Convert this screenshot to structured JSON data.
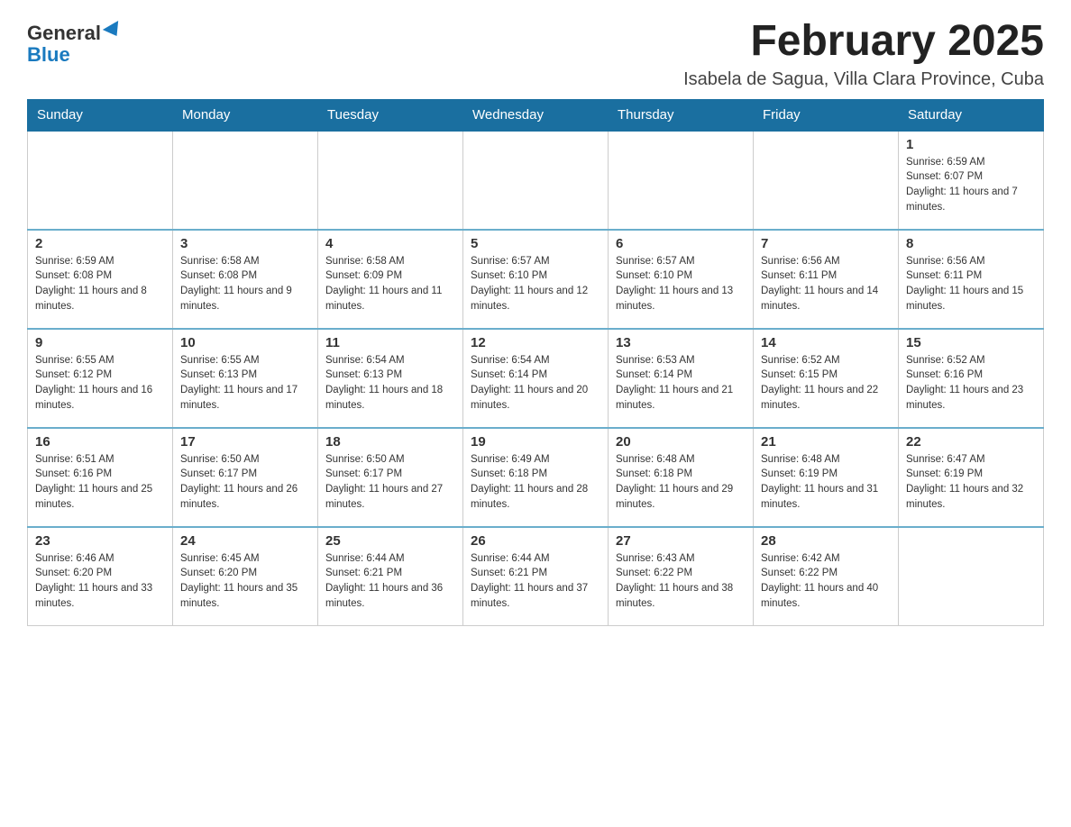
{
  "header": {
    "logo_line1": "General",
    "logo_line2": "Blue",
    "month_title": "February 2025",
    "subtitle": "Isabela de Sagua, Villa Clara Province, Cuba"
  },
  "days_of_week": [
    "Sunday",
    "Monday",
    "Tuesday",
    "Wednesday",
    "Thursday",
    "Friday",
    "Saturday"
  ],
  "weeks": [
    [
      {
        "day": "",
        "info": ""
      },
      {
        "day": "",
        "info": ""
      },
      {
        "day": "",
        "info": ""
      },
      {
        "day": "",
        "info": ""
      },
      {
        "day": "",
        "info": ""
      },
      {
        "day": "",
        "info": ""
      },
      {
        "day": "1",
        "info": "Sunrise: 6:59 AM\nSunset: 6:07 PM\nDaylight: 11 hours and 7 minutes."
      }
    ],
    [
      {
        "day": "2",
        "info": "Sunrise: 6:59 AM\nSunset: 6:08 PM\nDaylight: 11 hours and 8 minutes."
      },
      {
        "day": "3",
        "info": "Sunrise: 6:58 AM\nSunset: 6:08 PM\nDaylight: 11 hours and 9 minutes."
      },
      {
        "day": "4",
        "info": "Sunrise: 6:58 AM\nSunset: 6:09 PM\nDaylight: 11 hours and 11 minutes."
      },
      {
        "day": "5",
        "info": "Sunrise: 6:57 AM\nSunset: 6:10 PM\nDaylight: 11 hours and 12 minutes."
      },
      {
        "day": "6",
        "info": "Sunrise: 6:57 AM\nSunset: 6:10 PM\nDaylight: 11 hours and 13 minutes."
      },
      {
        "day": "7",
        "info": "Sunrise: 6:56 AM\nSunset: 6:11 PM\nDaylight: 11 hours and 14 minutes."
      },
      {
        "day": "8",
        "info": "Sunrise: 6:56 AM\nSunset: 6:11 PM\nDaylight: 11 hours and 15 minutes."
      }
    ],
    [
      {
        "day": "9",
        "info": "Sunrise: 6:55 AM\nSunset: 6:12 PM\nDaylight: 11 hours and 16 minutes."
      },
      {
        "day": "10",
        "info": "Sunrise: 6:55 AM\nSunset: 6:13 PM\nDaylight: 11 hours and 17 minutes."
      },
      {
        "day": "11",
        "info": "Sunrise: 6:54 AM\nSunset: 6:13 PM\nDaylight: 11 hours and 18 minutes."
      },
      {
        "day": "12",
        "info": "Sunrise: 6:54 AM\nSunset: 6:14 PM\nDaylight: 11 hours and 20 minutes."
      },
      {
        "day": "13",
        "info": "Sunrise: 6:53 AM\nSunset: 6:14 PM\nDaylight: 11 hours and 21 minutes."
      },
      {
        "day": "14",
        "info": "Sunrise: 6:52 AM\nSunset: 6:15 PM\nDaylight: 11 hours and 22 minutes."
      },
      {
        "day": "15",
        "info": "Sunrise: 6:52 AM\nSunset: 6:16 PM\nDaylight: 11 hours and 23 minutes."
      }
    ],
    [
      {
        "day": "16",
        "info": "Sunrise: 6:51 AM\nSunset: 6:16 PM\nDaylight: 11 hours and 25 minutes."
      },
      {
        "day": "17",
        "info": "Sunrise: 6:50 AM\nSunset: 6:17 PM\nDaylight: 11 hours and 26 minutes."
      },
      {
        "day": "18",
        "info": "Sunrise: 6:50 AM\nSunset: 6:17 PM\nDaylight: 11 hours and 27 minutes."
      },
      {
        "day": "19",
        "info": "Sunrise: 6:49 AM\nSunset: 6:18 PM\nDaylight: 11 hours and 28 minutes."
      },
      {
        "day": "20",
        "info": "Sunrise: 6:48 AM\nSunset: 6:18 PM\nDaylight: 11 hours and 29 minutes."
      },
      {
        "day": "21",
        "info": "Sunrise: 6:48 AM\nSunset: 6:19 PM\nDaylight: 11 hours and 31 minutes."
      },
      {
        "day": "22",
        "info": "Sunrise: 6:47 AM\nSunset: 6:19 PM\nDaylight: 11 hours and 32 minutes."
      }
    ],
    [
      {
        "day": "23",
        "info": "Sunrise: 6:46 AM\nSunset: 6:20 PM\nDaylight: 11 hours and 33 minutes."
      },
      {
        "day": "24",
        "info": "Sunrise: 6:45 AM\nSunset: 6:20 PM\nDaylight: 11 hours and 35 minutes."
      },
      {
        "day": "25",
        "info": "Sunrise: 6:44 AM\nSunset: 6:21 PM\nDaylight: 11 hours and 36 minutes."
      },
      {
        "day": "26",
        "info": "Sunrise: 6:44 AM\nSunset: 6:21 PM\nDaylight: 11 hours and 37 minutes."
      },
      {
        "day": "27",
        "info": "Sunrise: 6:43 AM\nSunset: 6:22 PM\nDaylight: 11 hours and 38 minutes."
      },
      {
        "day": "28",
        "info": "Sunrise: 6:42 AM\nSunset: 6:22 PM\nDaylight: 11 hours and 40 minutes."
      },
      {
        "day": "",
        "info": ""
      }
    ]
  ]
}
